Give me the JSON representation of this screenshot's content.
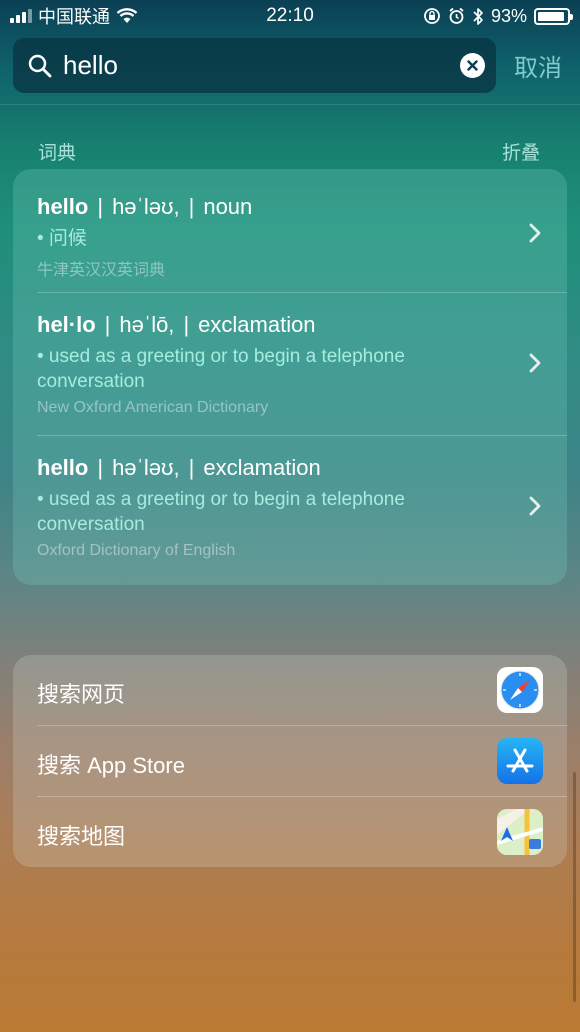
{
  "status_bar": {
    "carrier": "中国联通",
    "time": "22:10",
    "battery_text": "93%",
    "battery_level": 0.93
  },
  "search": {
    "query": "hello",
    "cancel_label": "取消"
  },
  "dictionary": {
    "section_title": "词典",
    "collapse_label": "折叠",
    "entries": [
      {
        "word": "hello",
        "pronunciation": "həˈləʊ,",
        "pos": "noun",
        "definition": "• 问候",
        "source": "牛津英汉汉英词典"
      },
      {
        "word": "hel·lo",
        "pronunciation": "həˈlō,",
        "pos": "exclamation",
        "definition": "• used as a greeting or to begin a telephone conversation",
        "source": "New Oxford American Dictionary"
      },
      {
        "word": "hello",
        "pronunciation": "həˈləʊ,",
        "pos": "exclamation",
        "definition": "• used as a greeting or to begin a telephone conversation",
        "source": "Oxford Dictionary of English"
      }
    ]
  },
  "actions": [
    {
      "label": "搜索网页",
      "icon": "safari-icon"
    },
    {
      "label": "搜索 App Store",
      "icon": "app-store-icon"
    },
    {
      "label": "搜索地图",
      "icon": "maps-icon"
    }
  ],
  "colors": {
    "accent_text": "#a5ecdf",
    "cancel": "#8cd7d7"
  }
}
